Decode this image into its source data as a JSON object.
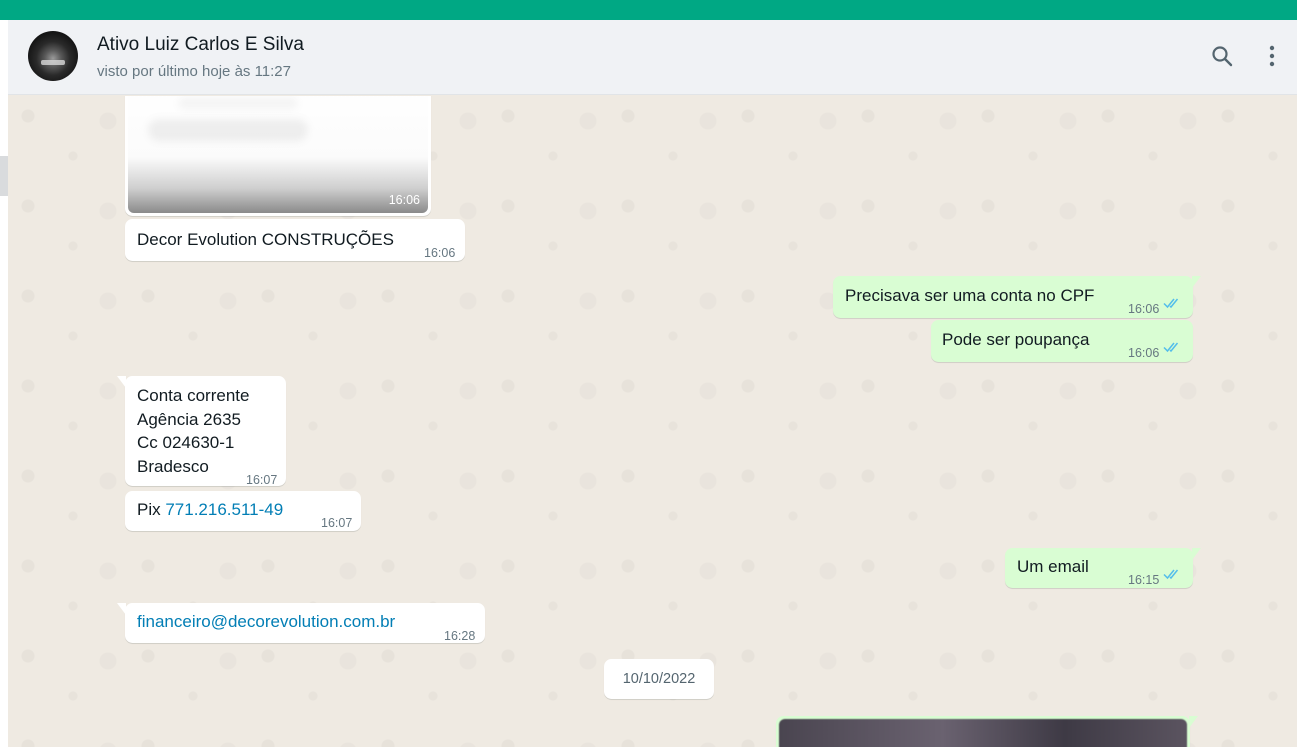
{
  "app": {
    "accent": "#00a884",
    "outgoing_bubble_color": "#d9fdd3",
    "incoming_bubble_color": "#ffffff",
    "link_color": "#027eb5"
  },
  "header": {
    "contact_name": "Ativo Luiz Carlos E Silva",
    "status": "visto por último hoje às 11:27",
    "icons": [
      "search-icon",
      "menu-icon"
    ]
  },
  "messages": [
    {
      "dir": "in",
      "kind": "image",
      "time": "16:06"
    },
    {
      "dir": "in",
      "text": "Decor Evolution CONSTRUÇÕES",
      "time": "16:06"
    },
    {
      "dir": "out",
      "text": "Precisava ser uma conta no CPF",
      "time": "16:06",
      "status": "read"
    },
    {
      "dir": "out",
      "text": "Pode ser poupança",
      "time": "16:06",
      "status": "read"
    },
    {
      "dir": "in",
      "lines": [
        "Conta corrente",
        "Agência 2635",
        "Cc 024630-1",
        "Bradesco"
      ],
      "time": "16:07"
    },
    {
      "dir": "in",
      "prefix": "Pix ",
      "link": "771.216.511-49",
      "time": "16:07"
    },
    {
      "dir": "out",
      "text": "Um email",
      "time": "16:15",
      "status": "read"
    },
    {
      "dir": "in",
      "link": "financeiro@decorevolution.com.br",
      "time": "16:28"
    },
    {
      "dir": "out",
      "kind": "image"
    }
  ],
  "date_divider": "10/10/2022"
}
